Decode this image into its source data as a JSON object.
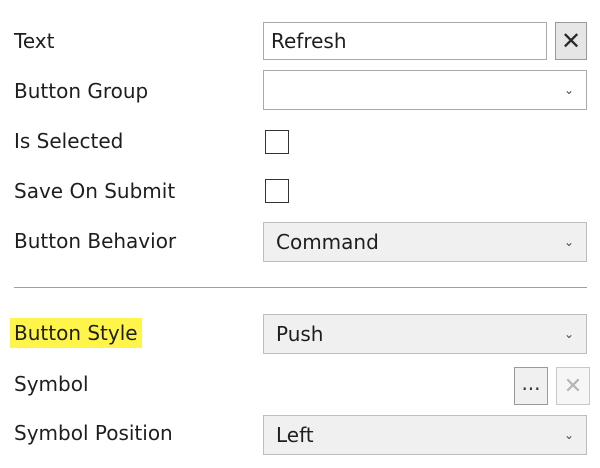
{
  "fields": {
    "text": {
      "label": "Text",
      "value": "Refresh",
      "clear_icon": "✕"
    },
    "button_group": {
      "label": "Button Group",
      "value": ""
    },
    "is_selected": {
      "label": "Is Selected",
      "checked": false
    },
    "save_on_submit": {
      "label": "Save On Submit",
      "checked": false
    },
    "button_behavior": {
      "label": "Button Behavior",
      "value": "Command"
    },
    "button_style": {
      "label": "Button Style",
      "value": "Push"
    },
    "symbol": {
      "label": "Symbol",
      "browse_label": "...",
      "clear_icon": "✕"
    },
    "symbol_position": {
      "label": "Symbol Position",
      "value": "Left"
    }
  },
  "icons": {
    "chevron": "chevron-down-icon",
    "clear": "close-icon"
  },
  "colors": {
    "highlight": "#fff54a",
    "combo_gray": "#f0f0f0",
    "border": "#a9a9a9"
  }
}
